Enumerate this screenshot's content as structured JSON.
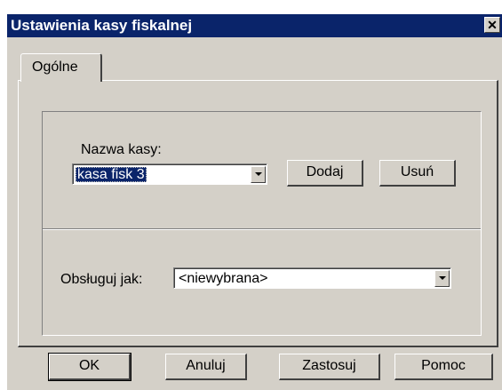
{
  "window": {
    "title": "Ustawienia kasy fiskalnej",
    "close_icon": "close-icon"
  },
  "tabs": [
    {
      "label": "Ogólne",
      "selected": true
    }
  ],
  "register": {
    "name_label": "Nazwa kasy:",
    "selected_value": "kasa fisk 3",
    "add_label": "Dodaj",
    "remove_label": "Usuń"
  },
  "handling": {
    "label": "Obsługuj jak:",
    "selected_value": "<niewybrana>"
  },
  "buttons": {
    "ok": "OK",
    "cancel": "Anuluj",
    "apply": "Zastosuj",
    "help": "Pomoc"
  },
  "colors": {
    "face": "#d4d0c8",
    "titlebar": "#0a246a",
    "selection": "#0a246a"
  }
}
